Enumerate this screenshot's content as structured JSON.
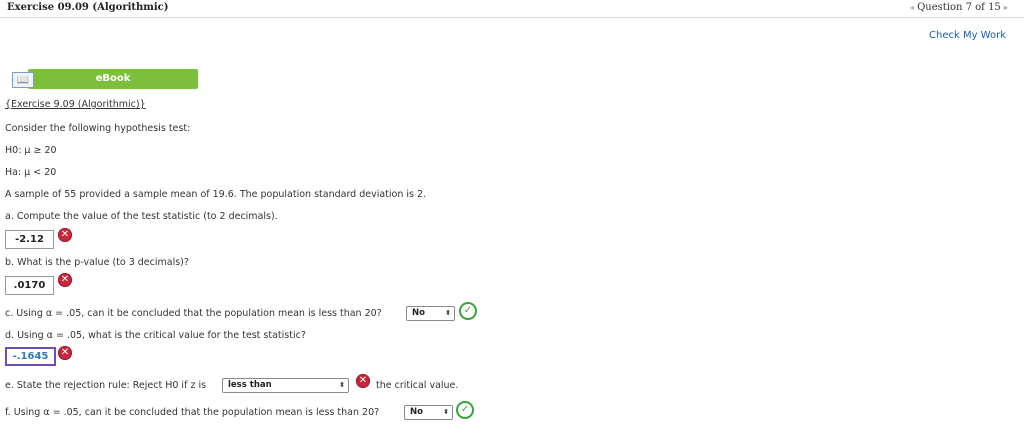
{
  "header": {
    "title": "Exercise 09.09 (Algorithmic)",
    "question_nav": "Question 7 of 15",
    "prev_arrow": "◂",
    "next_arrow": "▸"
  },
  "check_my_work": "Check My Work",
  "ebook": {
    "label": "eBook",
    "icon_glyph": "📖"
  },
  "exercise_link": "{Exercise 9.09 (Algorithmic)}",
  "intro": "Consider the following hypothesis test:",
  "h0": "H0: μ ≥ 20",
  "ha": "Ha: μ < 20",
  "sample_text": "A sample of 55 provided a sample mean of 19.6. The population standard deviation is 2.",
  "qa": {
    "prompt": "a. Compute the value of the test statistic (to 2 decimals).",
    "answer": "-2.12"
  },
  "qb": {
    "prompt": "b. What is the p-value (to 3 decimals)?",
    "answer": ".0170"
  },
  "qc": {
    "prompt": "c. Using α = .05, can it be concluded that the population mean is less than 20?",
    "selected": "No"
  },
  "qd": {
    "prompt": "d. Using α = .05, what is the critical value for the test statistic?",
    "answer": "-.1645"
  },
  "qe": {
    "prompt": "e. State the rejection rule: Reject H0 if z is",
    "selected": "less than",
    "suffix": "the critical value."
  },
  "qf": {
    "prompt": "f. Using α = .05, can it be concluded that the population mean is less than 20?",
    "selected": "No"
  },
  "icons": {
    "wrong": "✕",
    "right": "✓",
    "caret": "⬍"
  },
  "colors": {
    "wrong": "#c7283b",
    "right": "#37a437",
    "ebook_bar": "#7cbf3b",
    "link_blue": "#1b5ea8",
    "focus_border": "#6b4fb3"
  }
}
